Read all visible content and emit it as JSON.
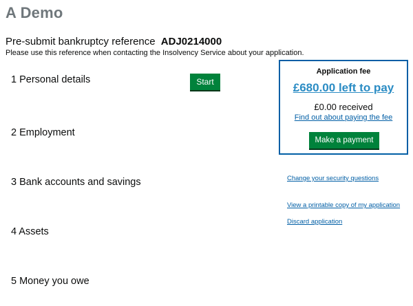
{
  "app": {
    "title": "A Demo"
  },
  "reference": {
    "label": "Pre-submit bankruptcy reference",
    "code": "ADJ0214000",
    "note": "Please use this reference when contacting the Insolvency Service about your application."
  },
  "sections": [
    {
      "label": "1 Personal details",
      "action_label": "Start"
    },
    {
      "label": "2 Employment"
    },
    {
      "label": "3 Bank accounts and savings"
    },
    {
      "label": "4 Assets"
    },
    {
      "label": "5 Money you owe"
    }
  ],
  "fee": {
    "heading": "Application fee",
    "amount_link": "£680.00 left to pay",
    "received": "£0.00 received",
    "info_link": "Find out about paying the fee",
    "pay_button": "Make a payment"
  },
  "side_links": {
    "security": "Change your security questions",
    "printable": "View a printable copy of my application",
    "discard": "Discard application"
  },
  "colors": {
    "button_green": "#00823b",
    "link_blue": "#005ea5",
    "amount_blue": "#2b8cc4",
    "box_border": "#005ea5",
    "title_grey": "#6f777b"
  }
}
